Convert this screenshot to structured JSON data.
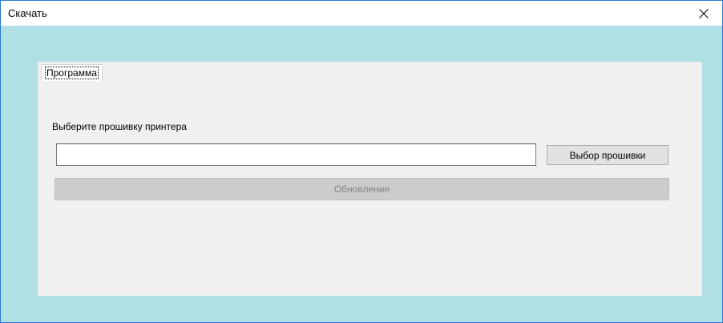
{
  "window": {
    "title": "Скачать",
    "close_icon": "close-icon"
  },
  "tabs": [
    {
      "label": "Программа",
      "selected": true
    }
  ],
  "firmware": {
    "prompt": "Выберите прошивку принтера",
    "path_value": "",
    "browse_label": "Выбор прошивки",
    "update_label": "Обновление",
    "update_enabled": false
  },
  "colors": {
    "window_background": "#b0dfe5",
    "panel_background": "#f0f0f0",
    "title_bar": "#ffffff",
    "window_border": "#2b79d4",
    "disabled_button": "#cccccc",
    "disabled_text": "#838383"
  }
}
